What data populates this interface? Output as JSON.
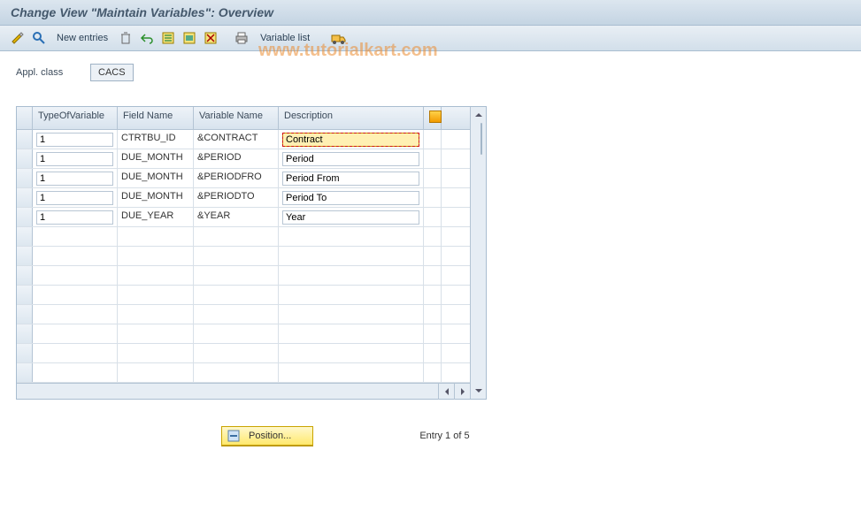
{
  "title": "Change View \"Maintain Variables\": Overview",
  "watermark": "www.tutorialkart.com",
  "toolbar": {
    "new_entries": "New entries",
    "variable_list": "Variable list"
  },
  "form": {
    "appl_class_label": "Appl. class",
    "appl_class_value": "CACS"
  },
  "table": {
    "columns": {
      "type": "TypeOfVariable",
      "field": "Field Name",
      "var": "Variable Name",
      "desc": "Description"
    },
    "rows": [
      {
        "type": "1",
        "field": "CTRTBU_ID",
        "var": "&CONTRACT",
        "desc": "Contract"
      },
      {
        "type": "1",
        "field": "DUE_MONTH",
        "var": "&PERIOD",
        "desc": "Period"
      },
      {
        "type": "1",
        "field": "DUE_MONTH",
        "var": "&PERIODFRO",
        "desc": "Period From"
      },
      {
        "type": "1",
        "field": "DUE_MONTH",
        "var": "&PERIODTO",
        "desc": "Period To"
      },
      {
        "type": "1",
        "field": "DUE_YEAR",
        "var": "&YEAR",
        "desc": "Year"
      }
    ],
    "empty_rows": 8
  },
  "footer": {
    "position_label": "Position...",
    "entry_text": "Entry 1 of 5"
  }
}
